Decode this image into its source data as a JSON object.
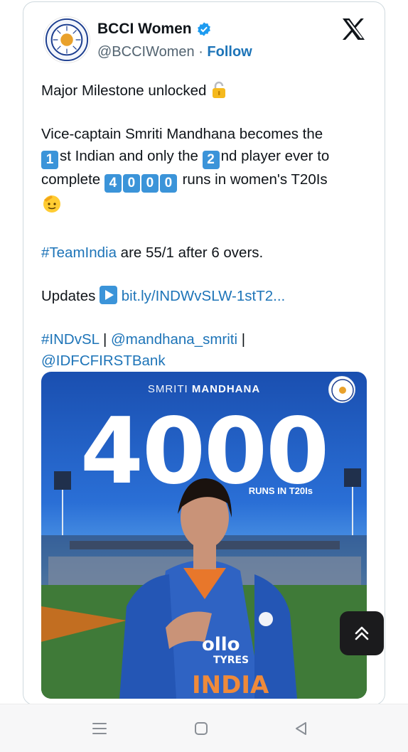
{
  "header": {
    "display_name": "BCCI Women",
    "handle": "@BCCIWomen",
    "separator": " · ",
    "follow_label": "Follow"
  },
  "tweet": {
    "line1": "Major Milestone unlocked",
    "line2_a": "Vice-captain Smriti Mandhana becomes the",
    "k1": "1",
    "line3_a": "st Indian and only the",
    "k2": "2",
    "line3_b": "nd player ever to",
    "line4_a": "complete",
    "k4": [
      "4",
      "0",
      "0",
      "0"
    ],
    "line4_b": "runs in women's T20Is",
    "hashtag_team": "#TeamIndia",
    "score_text": " are 55/1 after 6 overs.",
    "updates_label": "Updates",
    "updates_link": "bit.ly/INDWvSLW-1stT2...",
    "hashtag_match": "#INDvSL",
    "pipe": " | ",
    "mention_smriti": "@mandhana_smriti",
    "pipe2": " |",
    "mention_bank": "@IDFCFIRSTBank"
  },
  "media": {
    "top_light": "SMRITI ",
    "top_bold": "MANDHANA",
    "big_number": "4000",
    "runs_label": "RUNS IN T20Is",
    "jersey_sponsor": "ollo",
    "jersey_tyres": "TYRES",
    "jersey_country": "INDIA"
  },
  "icons": {
    "verified": "verified-badge-icon",
    "x": "x-logo-icon",
    "lock": "lock-icon",
    "play": "play-icon",
    "scroll_top": "chevron-up-icon",
    "nav_menu": "menu-icon",
    "nav_home": "home-icon",
    "nav_back": "back-icon"
  },
  "colors": {
    "link": "#1d74b8",
    "keycap": "#3b94d9",
    "verified": "#1d9bf0"
  }
}
